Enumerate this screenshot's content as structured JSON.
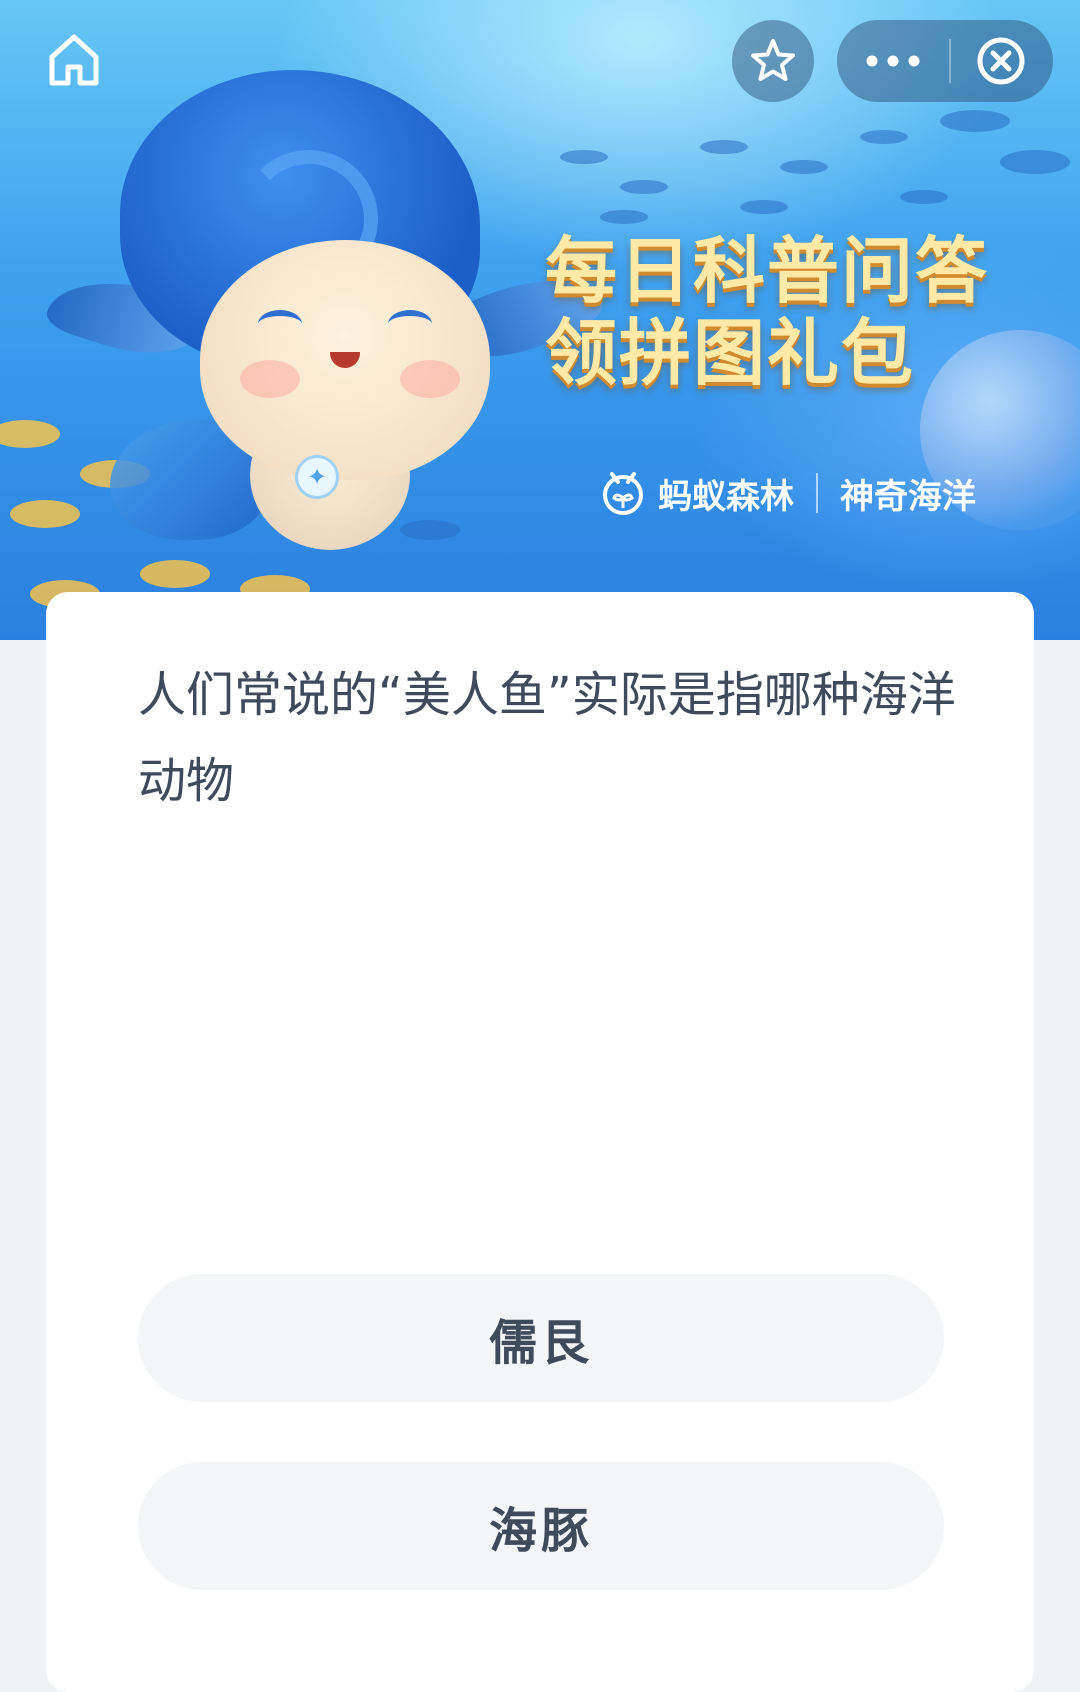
{
  "banner": {
    "title_line1": "每日科普问答",
    "title_line2": "领拼图礼包",
    "brand_left": "蚂蚁森林",
    "brand_right": "神奇海洋"
  },
  "topbar": {
    "home_icon": "home-icon",
    "favorite_icon": "star-icon",
    "more_icon": "more-icon",
    "close_icon": "close-icon"
  },
  "quiz": {
    "question": "人们常说的“美人鱼”实际是指哪种海洋动物",
    "options": [
      {
        "label": "儒艮"
      },
      {
        "label": "海豚"
      }
    ]
  },
  "colors": {
    "banner_blue": "#3d9fee",
    "title_gold": "#ffe9a6",
    "text_dark": "#3f4a5a",
    "option_bg": "#f4f5f7",
    "page_bg": "#f1f2f4"
  }
}
